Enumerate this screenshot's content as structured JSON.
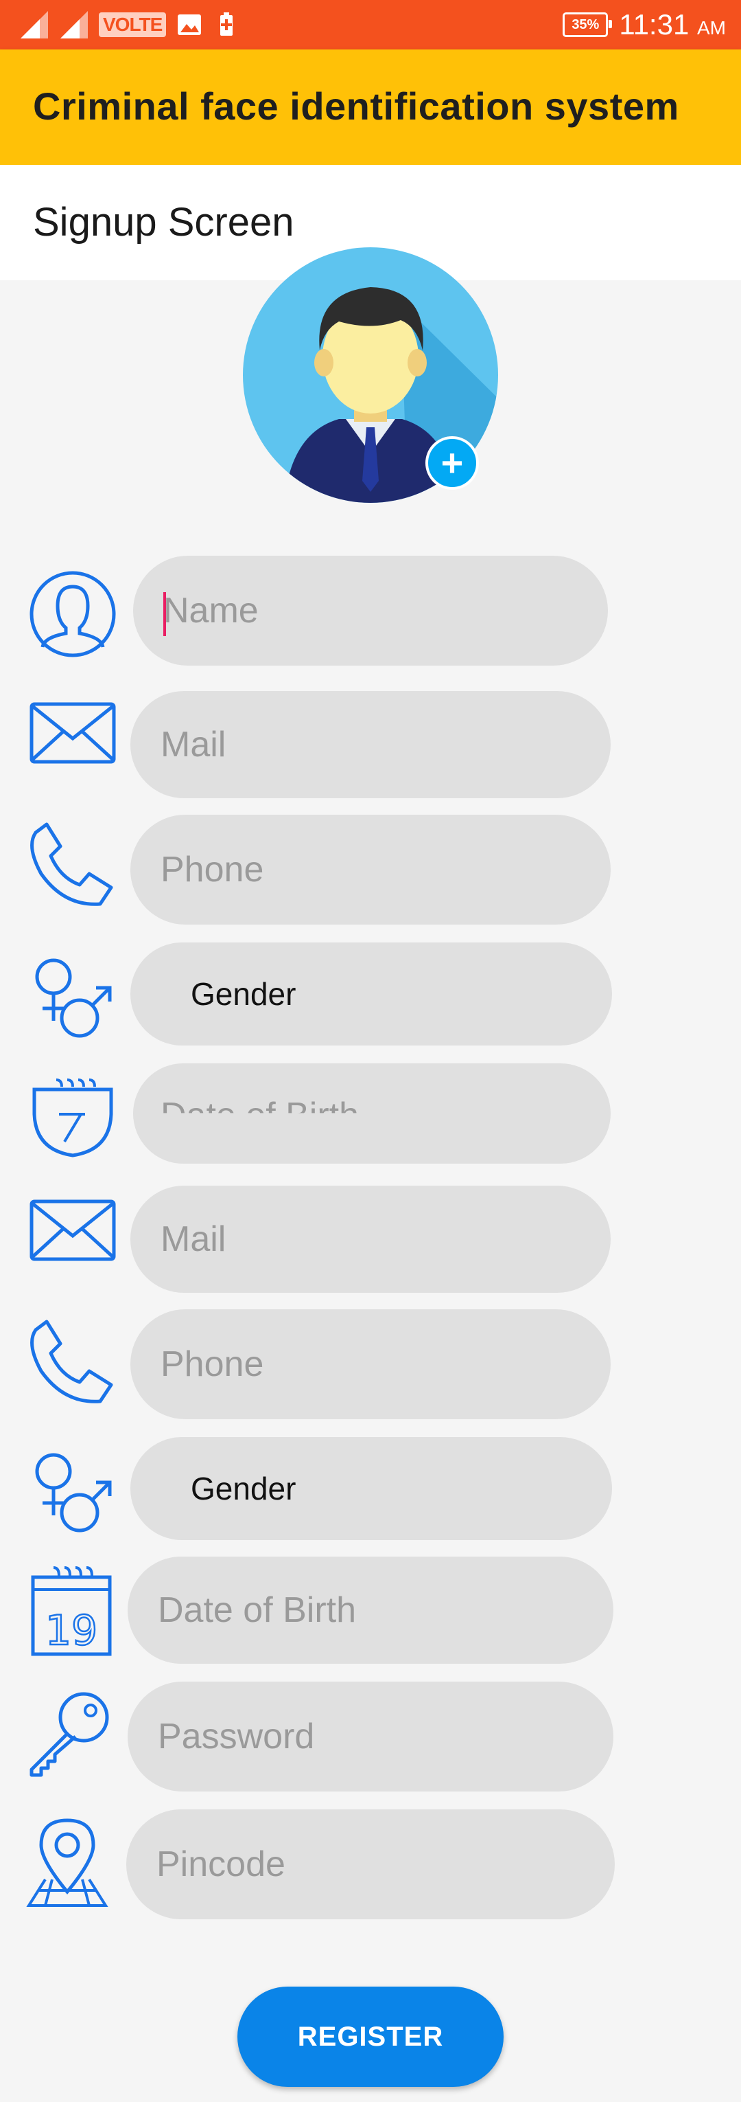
{
  "status_bar": {
    "volte_label": "VOLTE",
    "battery": "35%",
    "time": "11:31",
    "ampm": "AM"
  },
  "app_bar": {
    "title": "Criminal face identification system"
  },
  "screen": {
    "title": "Signup Screen"
  },
  "avatar": {
    "add_symbol": "+"
  },
  "fields": {
    "name_placeholder": "Name",
    "mail1_placeholder": "Mail",
    "phone1_placeholder": "Phone",
    "gender1_value": "Gender",
    "dob1_placeholder": "Date of Birth",
    "mail2_placeholder": "Mail",
    "phone2_placeholder": "Phone",
    "gender2_value": "Gender",
    "dob2_placeholder": "Date of Birth",
    "password_placeholder": "Password",
    "pincode_placeholder": "Pincode"
  },
  "calendar_day": "19",
  "register_label": "REGISTER",
  "colors": {
    "status_bar": "#f4511e",
    "app_bar": "#ffc107",
    "icon_blue": "#1a73e8",
    "button": "#0a84e8",
    "field_bg": "#e0e0e0"
  },
  "icons": [
    "signal-icon",
    "gallery-icon",
    "battery-saver-icon",
    "battery-icon",
    "person-icon",
    "mail-icon",
    "phone-icon",
    "gender-icon",
    "calendar-icon",
    "key-icon",
    "location-pin-icon"
  ]
}
